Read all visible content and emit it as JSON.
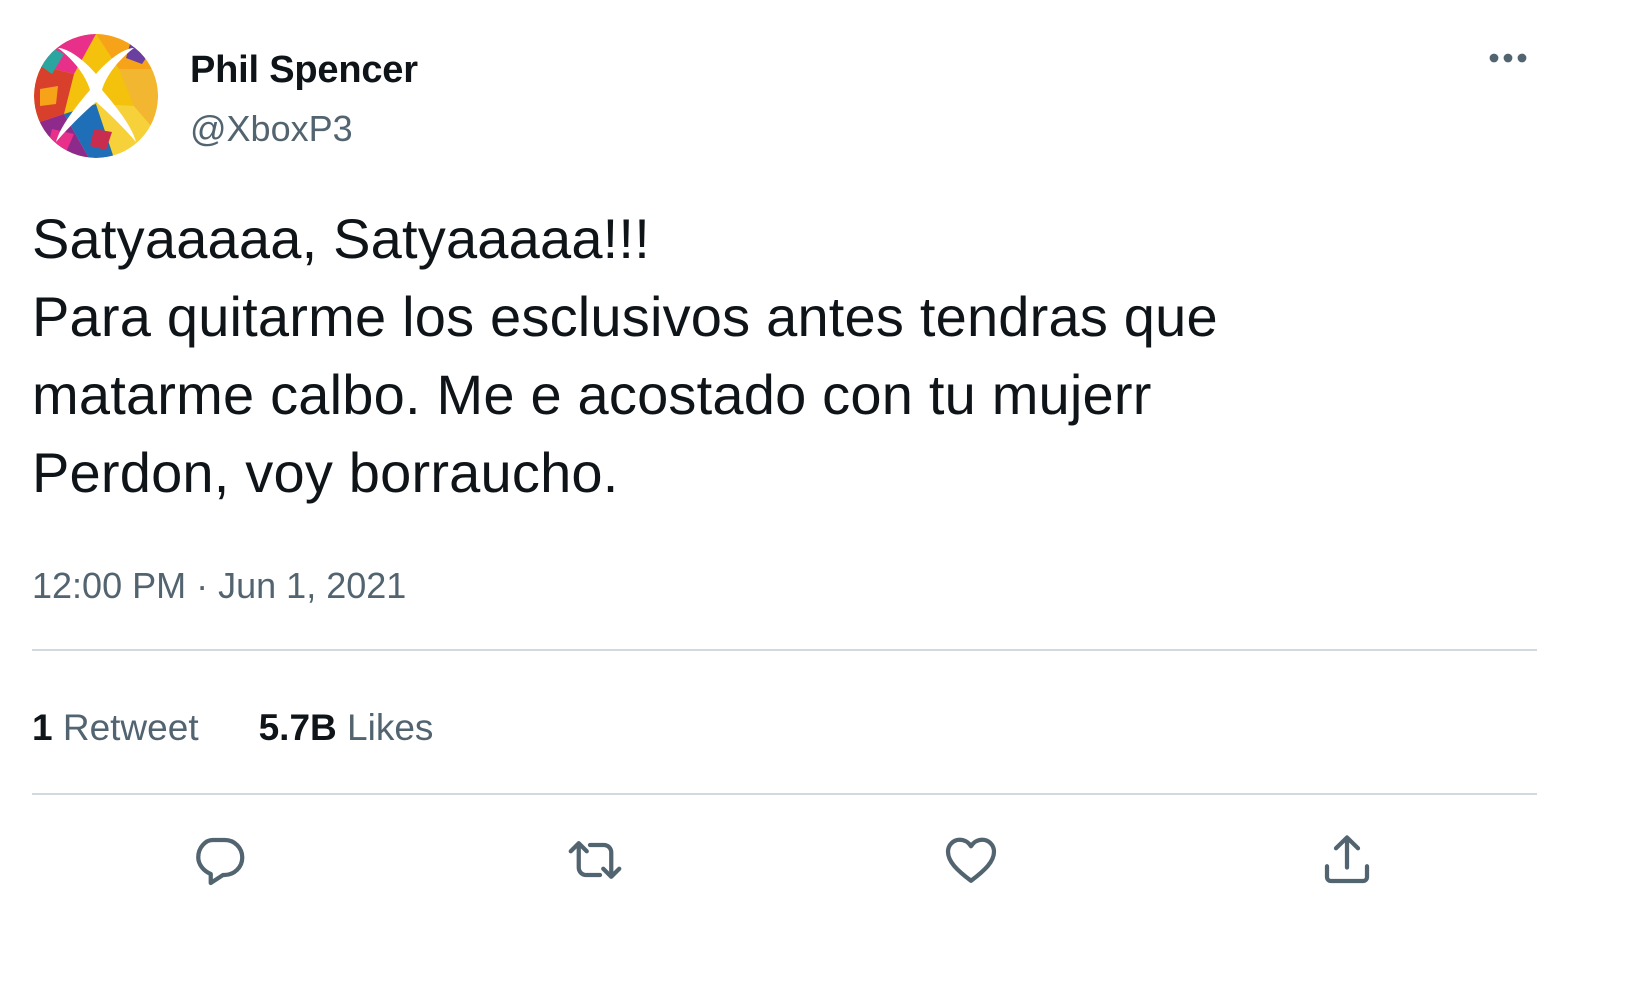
{
  "author": {
    "name": "Phil Spencer",
    "handle": "@XboxP3"
  },
  "tweet": {
    "lines": [
      "Satyaaaaa, Satyaaaaa!!!",
      "Para quitarme los esclusivos antes tendras que",
      "matarme calbo. Me e acostado con tu mujerr",
      "Perdon, voy borraucho."
    ],
    "time": "12:00 PM",
    "separator": "·",
    "date": "Jun 1, 2021"
  },
  "stats": {
    "retweets_count": "1",
    "retweets_label": "Retweet",
    "likes_count": "5.7B",
    "likes_label": "Likes"
  },
  "icons": {
    "more": "more-dots-icon",
    "reply": "reply-bubble-icon",
    "retweet": "retweet-icon",
    "like": "heart-icon",
    "share": "share-upload-icon"
  },
  "colors": {
    "text": "#0f1419",
    "secondary": "#536471",
    "divider": "#cfd9de"
  }
}
